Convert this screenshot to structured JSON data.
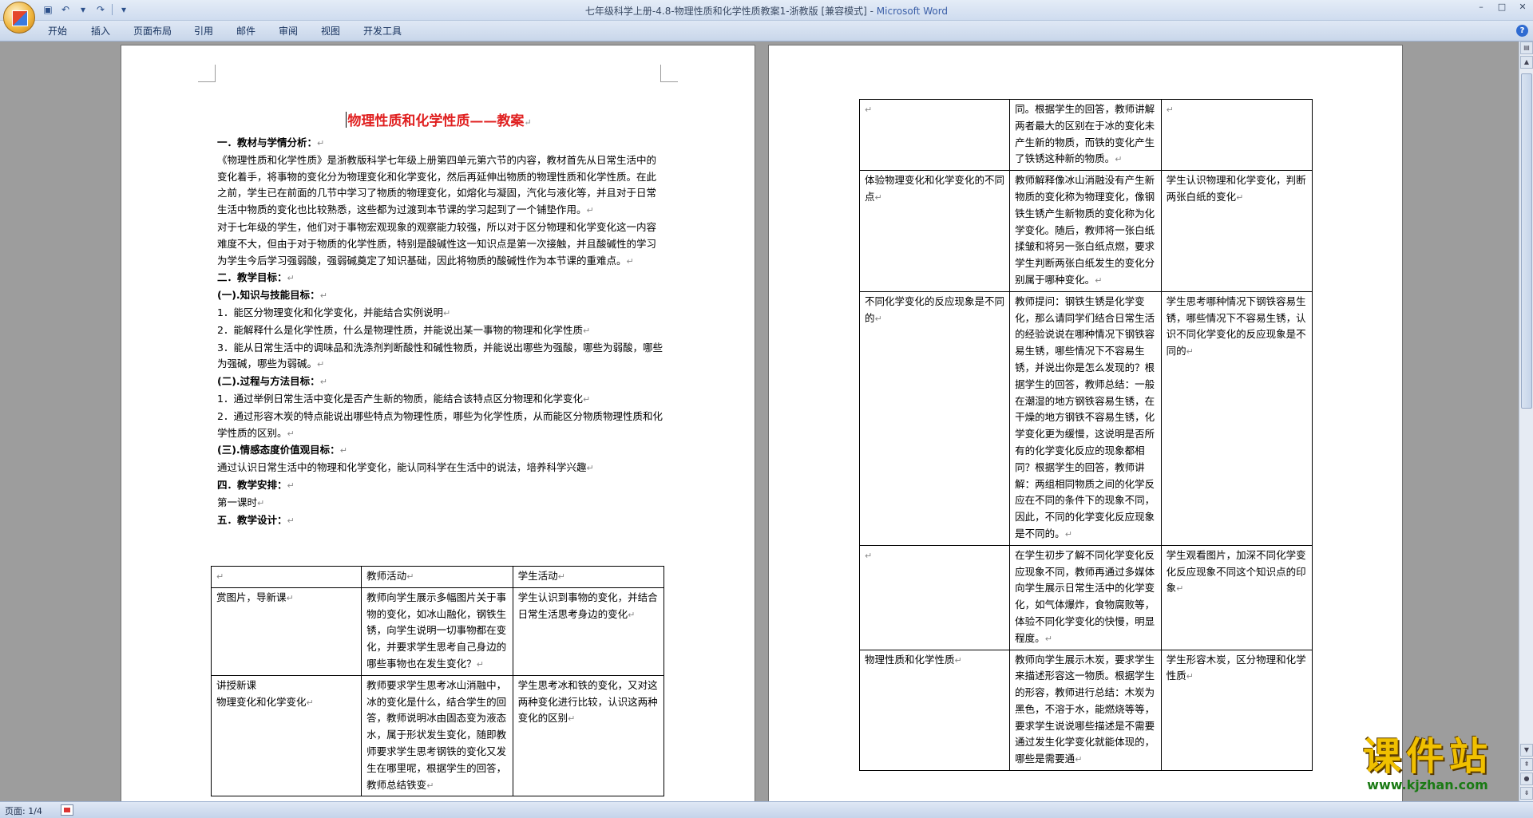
{
  "window": {
    "title": "七年级科学上册-4.8-物理性质和化学性质教案1-浙教版 [兼容模式] - ",
    "app_name": "Microsoft Word"
  },
  "ribbon_tabs": [
    "开始",
    "插入",
    "页面布局",
    "引用",
    "邮件",
    "审阅",
    "视图",
    "开发工具"
  ],
  "status": {
    "page": "页面: 1/4"
  },
  "page1": {
    "title": "物理性质和化学性质——教案",
    "lines": [
      {
        "text": "一．教材与学情分析：",
        "bold": true
      },
      {
        "text": "《物理性质和化学性质》是浙教版科学七年级上册第四单元第六节的内容，教材首先从日常生活中的变化着手，将事物的变化分为物理变化和化学变化，然后再延伸出物质的物理性质和化学性质。在此之前，学生已在前面的几节中学习了物质的物理变化，如熔化与凝固，汽化与液化等，并且对于日常生活中物质的变化也比较熟悉，这些都为过渡到本节课的学习起到了一个铺垫作用。",
        "bold": false
      },
      {
        "text": "对于七年级的学生，他们对于事物宏观现象的观察能力较强，所以对于区分物理和化学变化这一内容难度不大，但由于对于物质的化学性质，特别是酸碱性这一知识点是第一次接触，并且酸碱性的学习为学生今后学习强弱酸，强弱碱奠定了知识基础，因此将物质的酸碱性作为本节课的重难点。",
        "bold": false
      },
      {
        "text": "二．教学目标：",
        "bold": true
      },
      {
        "text": "(一).知识与技能目标：",
        "bold": true
      },
      {
        "text": "1．能区分物理变化和化学变化，并能结合实例说明",
        "bold": false
      },
      {
        "text": "2．能解释什么是化学性质，什么是物理性质，并能说出某一事物的物理和化学性质",
        "bold": false
      },
      {
        "text": "3．能从日常生活中的调味品和洗涤剂判断酸性和碱性物质，并能说出哪些为强酸，哪些为弱酸，哪些为强碱，哪些为弱碱。",
        "bold": false
      },
      {
        "text": "(二).过程与方法目标：",
        "bold": true
      },
      {
        "text": "1．通过举例日常生活中变化是否产生新的物质，能结合该特点区分物理和化学变化",
        "bold": false
      },
      {
        "text": "2．通过形容木炭的特点能说出哪些特点为物理性质，哪些为化学性质，从而能区分物质物理性质和化学性质的区别。",
        "bold": false
      },
      {
        "text": "(三).情感态度价值观目标：",
        "bold": true
      },
      {
        "text": "通过认识日常生活中的物理和化学变化，能认同科学在生活中的说法，培养科学兴趣",
        "bold": false
      },
      {
        "text": "四．教学安排：",
        "bold": true
      },
      {
        "text": "第一课时",
        "bold": false
      },
      {
        "text": "五．教学设计：",
        "bold": true
      }
    ],
    "table": {
      "headers": [
        "",
        "教师活动",
        "学生活动"
      ],
      "rows": [
        [
          "赏图片，导新课",
          "教师向学生展示多幅图片关于事物的变化，如冰山融化，钢铁生锈，向学生说明一切事物都在变化，并要求学生思考自己身边的哪些事物也在发生变化？",
          "学生认识到事物的变化，并结合日常生活思考身边的变化"
        ],
        [
          "讲授新课\n物理变化和化学变化",
          "教师要求学生思考冰山消融中，冰的变化是什么，结合学生的回答，教师说明冰由固态变为液态水，属于形状发生变化，随即教师要求学生思考钢铁的变化又发生在哪里呢，根据学生的回答，教师总结铁变",
          "学生思考冰和铁的变化，又对这两种变化进行比较，认识这两种变化的区别"
        ]
      ]
    }
  },
  "page2": {
    "table": {
      "rows": [
        [
          "",
          "同。根据学生的回答，教师讲解两者最大的区别在于冰的变化未产生新的物质，而铁的变化产生了铁锈这种新的物质。",
          ""
        ],
        [
          "体验物理变化和化学变化的不同点",
          "教师解释像冰山消融没有产生新物质的变化称为物理变化，像钢铁生锈产生新物质的变化称为化学变化。随后，教师将一张白纸揉皱和将另一张白纸点燃，要求学生判断两张白纸发生的变化分别属于哪种变化。",
          "学生认识物理和化学变化，判断两张白纸的变化"
        ],
        [
          "不同化学变化的反应现象是不同的",
          "教师提问：钢铁生锈是化学变化，那么请同学们结合日常生活的经验说说在哪种情况下钢铁容易生锈，哪些情况下不容易生锈，并说出你是怎么发现的？根据学生的回答，教师总结：一般在潮湿的地方钢铁容易生锈，在干燥的地方钢铁不容易生锈，化学变化更为缓慢，这说明是否所有的化学变化反应的现象都相同？根据学生的回答，教师讲解：两组相同物质之间的化学反应在不同的条件下的现象不同，因此，不同的化学变化反应现象是不同的。",
          "学生思考哪种情况下钢铁容易生锈，哪些情况下不容易生锈，认识不同化学变化的反应现象是不同的"
        ],
        [
          "",
          "在学生初步了解不同化学变化反应现象不同，教师再通过多媒体向学生展示日常生活中的化学变化，如气体爆炸，食物腐败等，体验不同化学变化的快慢，明显程度。",
          "学生观看图片，加深不同化学变化反应现象不同这个知识点的印象"
        ],
        [
          "物理性质和化学性质",
          "教师向学生展示木炭，要求学生来描述形容这一物质。根据学生的形容，教师进行总结：木炭为黑色，不溶于水，能燃烧等等，要求学生说说哪些描述是不需要通过发生化学变化就能体现的，哪些是需要通",
          "学生形容木炭，区分物理和化学性质"
        ]
      ]
    }
  },
  "watermark": {
    "title": "课件站",
    "url": "www.kjzhan.com"
  }
}
